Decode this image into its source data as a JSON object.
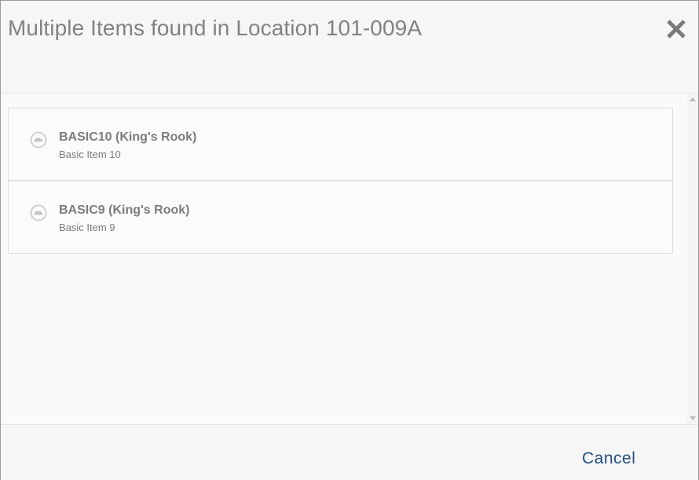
{
  "dialog": {
    "title": "Multiple Items found in Location 101-009A",
    "close_icon": "close-icon"
  },
  "items": [
    {
      "title": "BASIC10 (King's Rook)",
      "subtitle": "Basic Item 10",
      "icon": "item-cloud-icon"
    },
    {
      "title": "BASIC9 (King's Rook)",
      "subtitle": "Basic Item 9",
      "icon": "item-cloud-icon"
    }
  ],
  "footer": {
    "cancel_label": "Cancel"
  },
  "colors": {
    "title_text": "#828282",
    "item_text": "#7c7c7c",
    "cancel_text": "#1f4e8c",
    "background": "#f6f6f6"
  }
}
